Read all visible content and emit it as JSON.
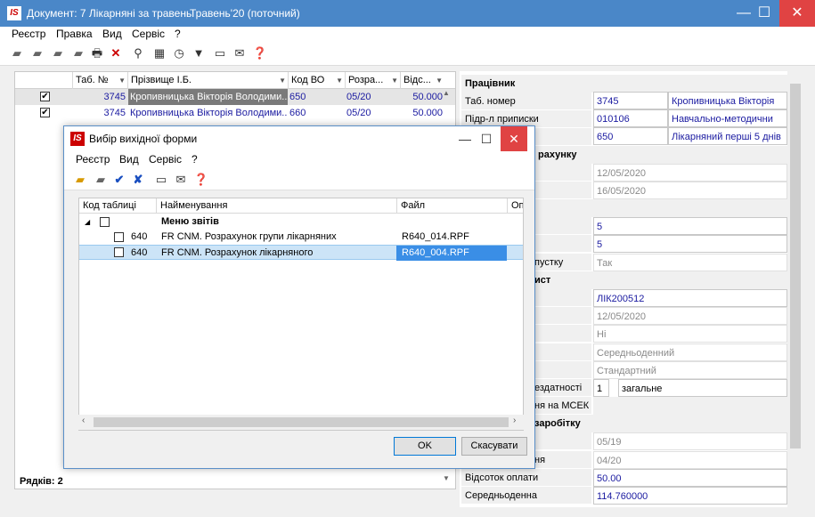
{
  "window": {
    "title": "Документ: 7 Лікарняні за травень",
    "period": "Травень'20 (поточний)",
    "logo": "IS"
  },
  "menu": [
    "Реєстр",
    "Правка",
    "Вид",
    "Сервіс",
    "?"
  ],
  "grid": {
    "columns": [
      "Таб. №",
      "Прізвище І.Б.",
      "Код ВО",
      "Розра...",
      "Відс..."
    ],
    "rows": [
      {
        "checked": "✔",
        "tab": "3745",
        "name": "Кропивницька Вікторія Володими...",
        "code": "650",
        "period": "05/20",
        "pct": "50.000"
      },
      {
        "checked": "✔",
        "tab": "3745",
        "name": "Кропивницька Вікторія Володими...",
        "code": "660",
        "period": "05/20",
        "pct": "50.000"
      }
    ],
    "rows_count_label": "Рядків: 2"
  },
  "right_panel": {
    "section_worker": "Працівник",
    "tab_label": "Таб. номер",
    "tab_value": "3745",
    "tab_name": "Кропивницька Вікторія",
    "dept_label": "Підр-л приписки",
    "dept_value": "010106",
    "dept_name": "Навчально-методични",
    "code_value": "650",
    "code_name": "Лікарняний перші 5 днів",
    "section_calc": "рахунку",
    "date1": "12/05/2020",
    "date2": "16/05/2020",
    "val5a": "5",
    "val5b": "5",
    "leave_label": "пустку",
    "leave_value": "Так",
    "section_list": "ист",
    "list_no": "ЛІК200512",
    "list_date": "12/05/2020",
    "no_value": "Ні",
    "avg_daily": "Середньоденний",
    "standard": "Стандартний",
    "disab_label": "ездатності",
    "disab_code": "1",
    "disab_name": "загальне",
    "msek_label": "ня на МСЕК",
    "section_salary": "заробітку",
    "sal_from": "05/19",
    "sal_to_label": "ня",
    "sal_to": "04/20",
    "pct_label": "Відсоток оплати",
    "pct_value": "50.00",
    "avg_label": "Середньоденна",
    "avg_value": "114.760000"
  },
  "dialog": {
    "title": "Вибір вихідної форми",
    "logo": "IS",
    "menu": [
      "Реєстр",
      "Вид",
      "Сервіс",
      "?"
    ],
    "columns": [
      "Код таблиці",
      "Найменування",
      "Файл",
      "Оп"
    ],
    "group_label": "Меню звітів",
    "rows": [
      {
        "code": "640",
        "name": "FR CNM. Розрахунок групи лікарняних",
        "file": "R640_014.RPF"
      },
      {
        "code": "640",
        "name": "FR CNM. Розрахунок лікарняного",
        "file": "R640_004.RPF"
      }
    ],
    "ok_label": "OK",
    "cancel_label": "Скасувати"
  }
}
